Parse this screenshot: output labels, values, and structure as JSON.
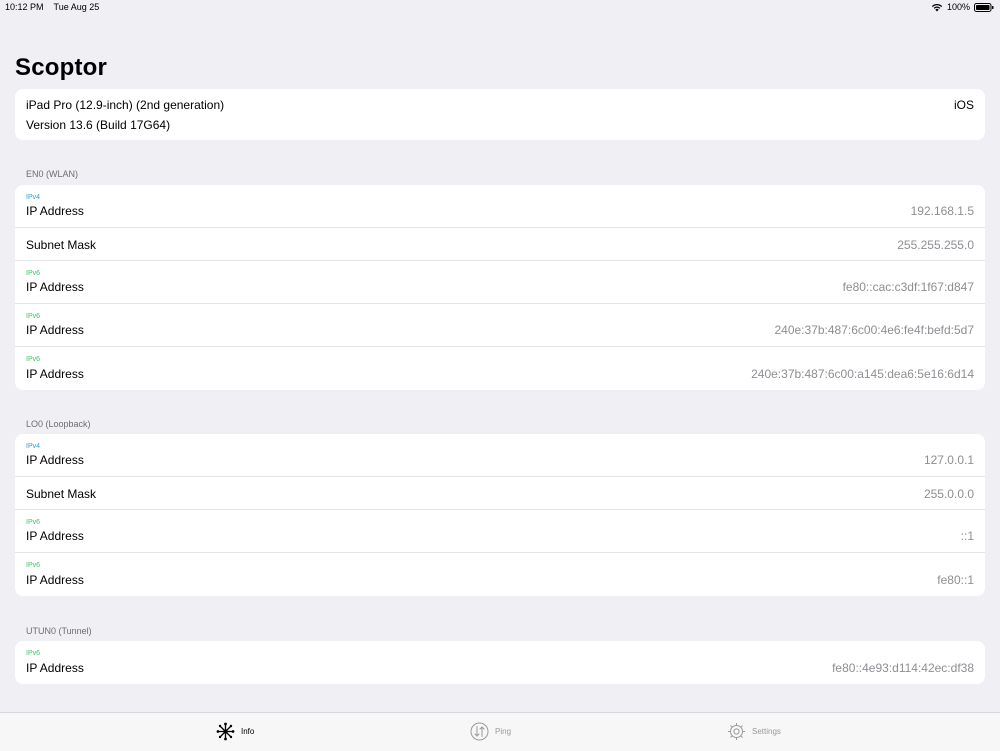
{
  "status": {
    "time": "10:12 PM",
    "date": "Tue Aug 25",
    "battery": "100%"
  },
  "app": {
    "title": "Scoptor"
  },
  "device": {
    "model": "iPad Pro (12.9-inch) (2nd generation)",
    "version": "Version 13.6 (Build 17G64)",
    "os": "iOS"
  },
  "sections": [
    {
      "header": "EN0 (WLAN)",
      "rows": [
        {
          "tag": "IPv4",
          "label": "IP Address",
          "value": "192.168.1.5"
        },
        {
          "tag": "",
          "label": "Subnet Mask",
          "value": "255.255.255.0"
        },
        {
          "tag": "IPv6",
          "label": "IP Address",
          "value": "fe80::cac:c3df:1f67:d847"
        },
        {
          "tag": "IPv6",
          "label": "IP Address",
          "value": "240e:37b:487:6c00:4e6:fe4f:befd:5d7"
        },
        {
          "tag": "IPv6",
          "label": "IP Address",
          "value": "240e:37b:487:6c00:a145:dea6:5e16:6d14"
        }
      ]
    },
    {
      "header": "LO0 (Loopback)",
      "rows": [
        {
          "tag": "IPv4",
          "label": "IP Address",
          "value": "127.0.0.1"
        },
        {
          "tag": "",
          "label": "Subnet Mask",
          "value": "255.0.0.0"
        },
        {
          "tag": "IPv6",
          "label": "IP Address",
          "value": "::1"
        },
        {
          "tag": "IPv6",
          "label": "IP Address",
          "value": "fe80::1"
        }
      ]
    },
    {
      "header": "UTUN0 (Tunnel)",
      "rows": [
        {
          "tag": "IPv6",
          "label": "IP Address",
          "value": "fe80::4e93:d114:42ec:df38"
        }
      ]
    }
  ],
  "tabs": [
    {
      "label": "Info",
      "icon": "network-icon",
      "selected": true
    },
    {
      "label": "Ping",
      "icon": "ping-arrows-icon",
      "selected": false
    },
    {
      "label": "Settings",
      "icon": "gear-icon",
      "selected": false
    }
  ],
  "colors": {
    "background": "#efeff4",
    "ipv4_tag": "#2aa0d6",
    "ipv6_tag": "#3ec363",
    "value_text": "#8e8e93"
  }
}
